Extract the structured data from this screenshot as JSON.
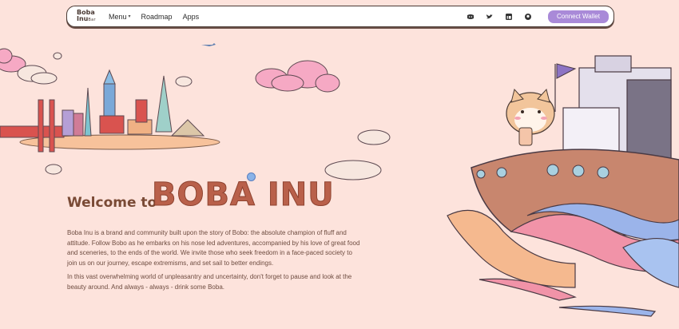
{
  "nav": {
    "logo_line1": "Boba",
    "logo_line2": "Inu",
    "logo_sub": "Bar",
    "links": [
      {
        "label": "Menu",
        "has_dropdown": true
      },
      {
        "label": "Roadmap",
        "has_dropdown": false
      },
      {
        "label": "Apps",
        "has_dropdown": false
      }
    ],
    "social_icons": [
      "discord-icon",
      "twitter-icon",
      "linkedin-icon",
      "github-icon"
    ],
    "connect_label": "Connect Wallet"
  },
  "hero": {
    "welcome": "Welcome to",
    "brand": "BOBA INU",
    "paragraph1": "Boba Inu is a brand and community built upon the story of Bobo: the absolute champion of fluff and attitude. Follow Bobo as he embarks on his nose led adventures, accompanied by his love of great food and sceneries, to the ends of the world. We invite those who seek freedom in a face-paced society to join us on our journey, escape extremisms, and set sail to better endings.",
    "paragraph2": "In this vast overwhelming world of unpleasantry and uncertainty, don't forget to pause and look at the beauty around. And always - always - drink some Boba."
  },
  "colors": {
    "background": "#fde3dc",
    "accent": "#a98ad8",
    "brand": "#b9604a",
    "text": "#6e4c40"
  }
}
